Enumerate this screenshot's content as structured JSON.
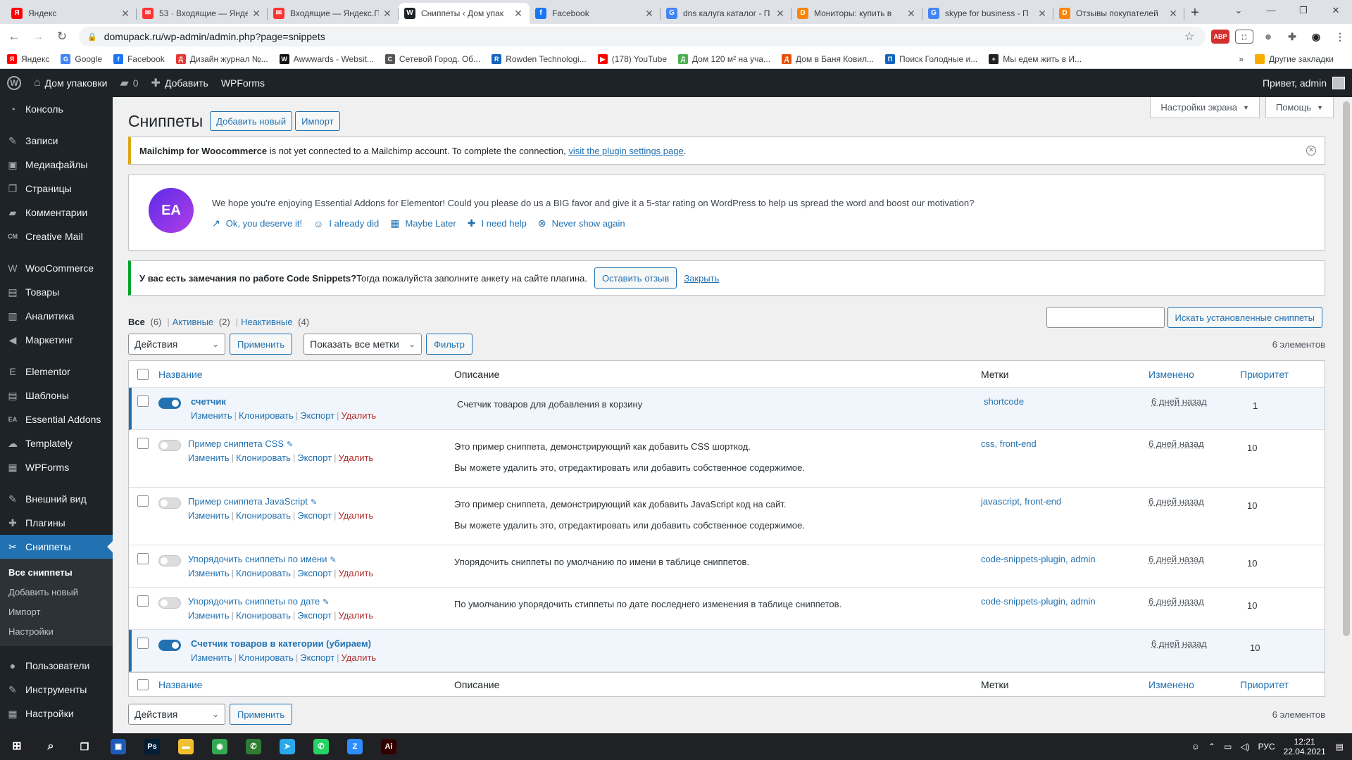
{
  "browser": {
    "tabs": [
      {
        "title": "Яндекс",
        "fav": "Я",
        "color": "#ff0000"
      },
      {
        "title": "53 · Входящие — Яндекс",
        "fav": "✉",
        "color": "#ff3333"
      },
      {
        "title": "Входящие — Яндекс.П",
        "fav": "✉",
        "color": "#ff3333"
      },
      {
        "title": "Сниппеты ‹ Дом упак",
        "fav": "W",
        "color": "#1d2327"
      },
      {
        "title": "Facebook",
        "fav": "f",
        "color": "#1877f2"
      },
      {
        "title": "dns калуга каталог - П",
        "fav": "G",
        "color": "#4285f4"
      },
      {
        "title": "Мониторы: купить в",
        "fav": "D",
        "color": "#fc8507"
      },
      {
        "title": "skype for business - П",
        "fav": "G",
        "color": "#4285f4"
      },
      {
        "title": "Отзывы покупателей",
        "fav": "D",
        "color": "#fc8507"
      }
    ],
    "url": "domupack.ru/wp-admin/admin.php?page=snippets",
    "bookmarks": [
      {
        "label": "Яндекс",
        "color": "#ff0000",
        "fav": "Я"
      },
      {
        "label": "Google",
        "color": "#4285f4",
        "fav": "G"
      },
      {
        "label": "Facebook",
        "color": "#1877f2",
        "fav": "f"
      },
      {
        "label": "Дизайн журнал №...",
        "color": "#e53935",
        "fav": "Д"
      },
      {
        "label": "Awwwards - Websit...",
        "color": "#111111",
        "fav": "W"
      },
      {
        "label": "Сетевой Город. Об...",
        "color": "#555555",
        "fav": "С"
      },
      {
        "label": "Rowden Technologi...",
        "color": "#1565c0",
        "fav": "R"
      },
      {
        "label": "(178) YouTube",
        "color": "#ff0000",
        "fav": "▶"
      },
      {
        "label": "Дом 120 м² на уча...",
        "color": "#4caf50",
        "fav": "Д"
      },
      {
        "label": "Дом в Баня Ковил...",
        "color": "#e65100",
        "fav": "Д"
      },
      {
        "label": "Поиск Голодные и...",
        "color": "#1565c0",
        "fav": "П"
      },
      {
        "label": "Мы едем жить в И...",
        "color": "#222222",
        "fav": "+"
      }
    ],
    "other_bookmarks": "Другие закладки"
  },
  "adminbar": {
    "site": "Дом упаковки",
    "comments": "0",
    "add": "Добавить",
    "wpforms": "WPForms",
    "greeting": "Привет, admin"
  },
  "sidebar": {
    "items": [
      {
        "label": "Консоль",
        "icon": "dashboard-icon",
        "glyph": "◔"
      },
      {
        "label": "Записи",
        "icon": "pin-icon",
        "glyph": "✎"
      },
      {
        "label": "Медиафайлы",
        "icon": "media-icon",
        "glyph": "▣"
      },
      {
        "label": "Страницы",
        "icon": "pages-icon",
        "glyph": "❐"
      },
      {
        "label": "Комментарии",
        "icon": "comments-icon",
        "glyph": "▰"
      },
      {
        "label": "Creative Mail",
        "icon": "creative-mail-icon",
        "glyph": "CM"
      },
      {
        "label": "WooCommerce",
        "icon": "woocommerce-icon",
        "glyph": "W"
      },
      {
        "label": "Товары",
        "icon": "products-icon",
        "glyph": "▤"
      },
      {
        "label": "Аналитика",
        "icon": "analytics-icon",
        "glyph": "▥"
      },
      {
        "label": "Маркетинг",
        "icon": "marketing-icon",
        "glyph": "◀"
      },
      {
        "label": "Elementor",
        "icon": "elementor-icon",
        "glyph": "E"
      },
      {
        "label": "Шаблоны",
        "icon": "templates-icon",
        "glyph": "▤"
      },
      {
        "label": "Essential Addons",
        "icon": "essential-addons-icon",
        "glyph": "EA"
      },
      {
        "label": "Templately",
        "icon": "templately-icon",
        "glyph": "☁"
      },
      {
        "label": "WPForms",
        "icon": "wpforms-icon",
        "glyph": "▦"
      },
      {
        "label": "Внешний вид",
        "icon": "appearance-icon",
        "glyph": "✎"
      },
      {
        "label": "Плагины",
        "icon": "plugins-icon",
        "glyph": "✚"
      },
      {
        "label": "Сниппеты",
        "icon": "snippets-icon",
        "glyph": "✂"
      }
    ],
    "submenu": [
      "Все сниппеты",
      "Добавить новый",
      "Импорт",
      "Настройки"
    ],
    "bottom": [
      {
        "label": "Пользователи",
        "icon": "users-icon",
        "glyph": "●"
      },
      {
        "label": "Инструменты",
        "icon": "tools-icon",
        "glyph": "✎"
      },
      {
        "label": "Настройки",
        "icon": "settings-icon",
        "glyph": "▦"
      }
    ]
  },
  "screen_options": {
    "screen": "Настройки экрана",
    "help": "Помощь"
  },
  "page": {
    "title": "Сниппеты",
    "add_new": "Добавить новый",
    "import": "Импорт"
  },
  "notice_mailchimp": {
    "bold": "Mailchimp for Woocommerce",
    "text": " is not yet connected to a Mailchimp account. To complete the connection, ",
    "link": "visit the plugin settings page",
    "end": "."
  },
  "notice_ea": {
    "logo": "EA",
    "text": "We hope you're enjoying Essential Addons for Elementor! Could you please do us a BIG favor and give it a 5-star rating on WordPress to help us spread the word and boost our motivation?",
    "links": [
      {
        "label": "Ok, you deserve it!",
        "glyph": "↗",
        "icon": "external-link-icon"
      },
      {
        "label": "I already did",
        "glyph": "☺",
        "icon": "smile-icon"
      },
      {
        "label": "Maybe Later",
        "glyph": "▦",
        "icon": "calendar-icon"
      },
      {
        "label": "I need help",
        "glyph": "✚",
        "icon": "help-icon"
      },
      {
        "label": "Never show again",
        "glyph": "⊗",
        "icon": "dismiss-icon"
      }
    ]
  },
  "notice_cs": {
    "bold": "У вас есть замечания по работе Code Snippets?",
    "text": " Тогда пожалуйста заполните анкету на сайте плагина.",
    "button": "Оставить отзыв",
    "close": "Закрыть"
  },
  "filters": {
    "all": "Все",
    "all_count": "(6)",
    "active": "Активные",
    "active_count": "(2)",
    "inactive": "Неактивные",
    "inactive_count": "(4)"
  },
  "search": {
    "button": "Искать установленные сниппеты"
  },
  "tablenav": {
    "actions": "Действия",
    "apply": "Применить",
    "tags": "Показать все метки",
    "filter": "Фильтр",
    "count": "6 элементов"
  },
  "columns": {
    "name": "Название",
    "description": "Описание",
    "tags": "Метки",
    "modified": "Изменено",
    "priority": "Приоритет"
  },
  "row_actions": {
    "edit": "Изменить",
    "clone": "Клонировать",
    "export": "Экспорт",
    "delete": "Удалить"
  },
  "snippets": [
    {
      "name": "счетчик",
      "active": true,
      "wrench": false,
      "desc1": "Счетчик товаров для добавления в корзину",
      "desc2": "",
      "tags": "shortcode",
      "modified": "6 дней назад",
      "priority": "1"
    },
    {
      "name": "Пример сниппета CSS",
      "active": false,
      "wrench": true,
      "desc1": "Это пример сниппета, демонстрирующий как добавить CSS шорткод.",
      "desc2": "Вы можете удалить это, отредактировать или добавить собственное содержимое.",
      "tags": "css, front-end",
      "modified": "6 дней назад",
      "priority": "10"
    },
    {
      "name": "Пример сниппета JavaScript",
      "active": false,
      "wrench": true,
      "desc1": "Это пример сниппета, демонстрирующий как добавить JavaScript код на сайт.",
      "desc2": "Вы можете удалить это, отредактировать или добавить собственное содержимое.",
      "tags": "javascript, front-end",
      "modified": "6 дней назад",
      "priority": "10"
    },
    {
      "name": "Упорядочить сниппеты по имени",
      "active": false,
      "wrench": true,
      "desc1": "Упорядочить сниппеты по умолчанию по имени в таблице сниппетов.",
      "desc2": "",
      "tags": "code-snippets-plugin, admin",
      "modified": "6 дней назад",
      "priority": "10"
    },
    {
      "name": "Упорядочить сниппеты по дате",
      "active": false,
      "wrench": true,
      "desc1": "По умолчанию упорядочить стиппеты по дате последнего изменения в таблице сниппетов.",
      "desc2": "",
      "tags": "code-snippets-plugin, admin",
      "modified": "6 дней назад",
      "priority": "10"
    },
    {
      "name": "Счетчик товаров в категории (убираем)",
      "active": true,
      "wrench": false,
      "desc1": "",
      "desc2": "",
      "tags": "",
      "modified": "6 дней назад",
      "priority": "10"
    }
  ],
  "taskbar": {
    "icons": [
      {
        "name": "save-app-icon",
        "glyph": "▣",
        "color": "#1e5bb8"
      },
      {
        "name": "photoshop-icon",
        "glyph": "Ps",
        "color": "#001e36"
      },
      {
        "name": "explorer-icon",
        "glyph": "▬",
        "color": "#f0c030"
      },
      {
        "name": "chrome-icon",
        "glyph": "◉",
        "color": "#34a853"
      },
      {
        "name": "phone-app-icon",
        "glyph": "✆",
        "color": "#2e7d32"
      },
      {
        "name": "telegram-icon",
        "glyph": "➤",
        "color": "#29a9eb"
      },
      {
        "name": "whatsapp-icon",
        "glyph": "✆",
        "color": "#25d366"
      },
      {
        "name": "zoom-icon",
        "glyph": "Z",
        "color": "#2d8cff"
      },
      {
        "name": "illustrator-icon",
        "glyph": "Ai",
        "color": "#330000"
      }
    ],
    "lang": "РУС",
    "time": "12:21",
    "date": "22.04.2021"
  }
}
